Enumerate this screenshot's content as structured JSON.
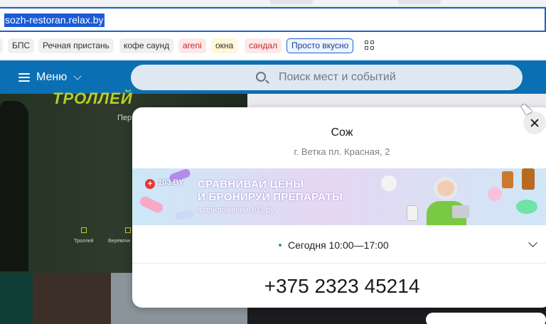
{
  "browser": {
    "url": "sozh-restoran.relax.by",
    "bookmarks": [
      {
        "label": "БПС",
        "style": "plain"
      },
      {
        "label": "Речная пристань",
        "style": "plain"
      },
      {
        "label": "кофе саунд",
        "style": "plain"
      },
      {
        "label": "areni",
        "style": "red"
      },
      {
        "label": "окна",
        "style": "yellow"
      },
      {
        "label": "сандал",
        "style": "red"
      },
      {
        "label": "Просто вкусно",
        "style": "outlined"
      }
    ],
    "apps_icon": "grid-icon"
  },
  "site_header": {
    "menu_label": "Меню",
    "search_placeholder": "Поиск мест и событий",
    "header_color": "#0b6fb3"
  },
  "hero": {
    "title": "ТРОЛЛЕЙ",
    "subtitle": "Пер",
    "label_1": "Троллей",
    "label_2": "Верёвочн"
  },
  "modal": {
    "title": "Сож",
    "address": "г. Ветка пл. Красная, 2",
    "banner": {
      "brand": "103.BY",
      "line1": "СРАВНИВАЙ ЦЕНЫ",
      "line2": "И БРОНИРУЙ ПРЕПАРАТЫ",
      "line3": "в приложении 103.by"
    },
    "schedule": "Сегодня 10:00—17:00",
    "phone": "+375 2323 45214"
  }
}
